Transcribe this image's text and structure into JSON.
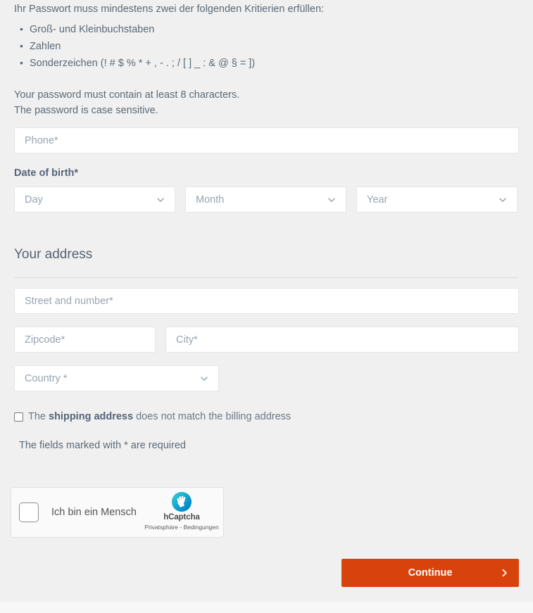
{
  "password_rules": {
    "intro": "Ihr Passwort muss mindestens zwei der folgenden Kritierien erfüllen:",
    "items": [
      "Groß- und Kleinbuchstaben",
      "Zahlen",
      "Sonderzeichen (! # $ % * + , - . ; / [ ] _ : & @ § = ])"
    ],
    "note_length": "Your password must contain at least 8 characters.",
    "note_case": "The password is case sensitive."
  },
  "phone": {
    "placeholder": "Phone*"
  },
  "date_of_birth": {
    "label": "Date of birth*",
    "day": {
      "value": "Day",
      "icon": "chevron-down-icon"
    },
    "month": {
      "value": "Month",
      "icon": "chevron-down-icon"
    },
    "year": {
      "value": "Year",
      "icon": "chevron-down-icon"
    }
  },
  "address": {
    "title": "Your address",
    "street": {
      "placeholder": "Street and number*"
    },
    "zipcode": {
      "placeholder": "Zipcode*"
    },
    "city": {
      "placeholder": "City*"
    },
    "country": {
      "value": "Country *",
      "icon": "chevron-down-icon"
    }
  },
  "shipping": {
    "prefix": "The ",
    "emphasis": "shipping address",
    "suffix": " does not match the billing address",
    "checked": false
  },
  "required_note": "The fields marked with * are required",
  "captcha": {
    "provider": "hCaptcha",
    "label": "Ich bin ein Mensch",
    "brand": "hCaptcha",
    "privacy_link": "Privatsphäre",
    "separator": " - ",
    "terms_link": "Bedingungen",
    "logo_icon": "hcaptcha-hand-icon",
    "checked": false
  },
  "continue_button": {
    "label": "Continue",
    "icon": "chevron-right-icon"
  },
  "colors": {
    "background": "#f0f0f0",
    "accent": "#d8420d",
    "text": "#5a6a78",
    "placeholder": "#97a4b1",
    "field_bg": "#ffffff",
    "field_border": "#e6e6e6",
    "divider": "#dcdcdc",
    "captcha_logo_top": "#3dcfcf",
    "captcha_logo_bottom": "#0074bf"
  }
}
